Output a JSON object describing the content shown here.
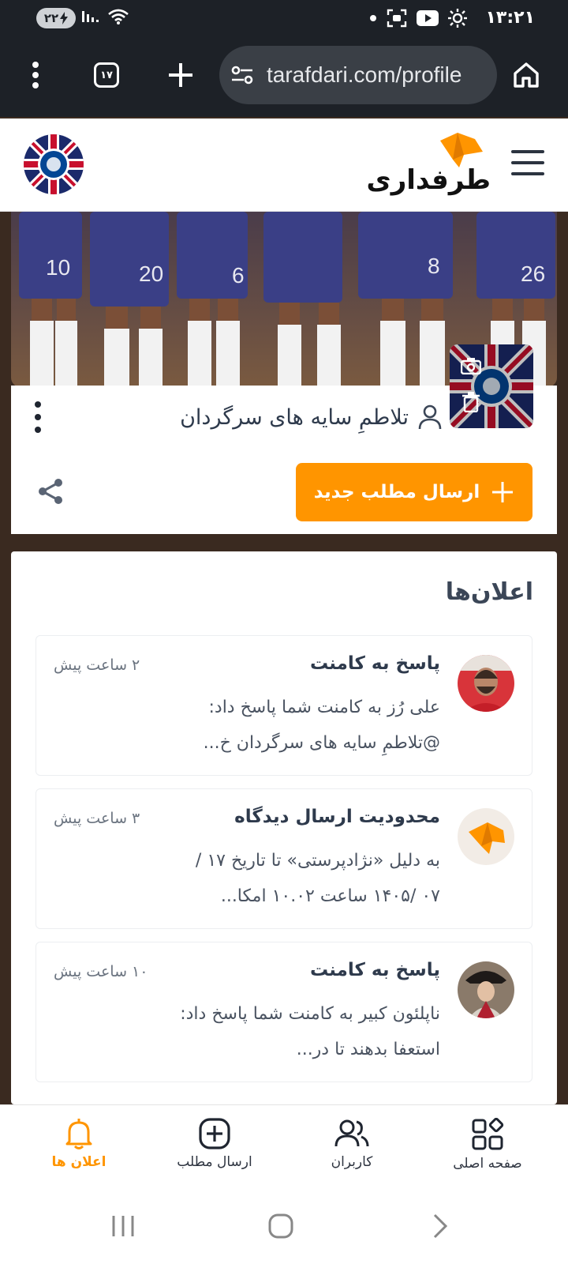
{
  "status_bar": {
    "time": "۱۳:۲۱",
    "battery_level": "۲۲"
  },
  "browser": {
    "url": "tarafdari.com/profile",
    "tab_count": "۱۷"
  },
  "site": {
    "logo_text": "طرفداری",
    "brand_color": "#ff9500"
  },
  "profile": {
    "name": "تلاطمِ سایه های سرگردان",
    "new_post_label": "ارسال مطلب جدید"
  },
  "notifications": {
    "title": "اعلان‌ها",
    "items": [
      {
        "heading": "پاسخ به کامنت",
        "time": "۲ ساعت پیش",
        "body": "علی رُز به کامنت شما پاسخ داد: @تلاطمِ سایه های سرگردان خ...",
        "avatar": "player-avatar"
      },
      {
        "heading": "محدودیت ارسال دیدگاه",
        "time": "۳ ساعت پیش",
        "body": "به دلیل «نژادپرستی» تا تاریخ ۱۷ /۰۷ /۱۴۰۵ ساعت ۱۰.۰۲ امکا...",
        "avatar": "tarafdari-logo-avatar"
      },
      {
        "heading": "پاسخ به کامنت",
        "time": "۱۰ ساعت پیش",
        "body": "ناپلئون کبیر به کامنت شما پاسخ داد: استعفا بدهند تا در...",
        "avatar": "napoleon-avatar"
      }
    ]
  },
  "bottom_nav": {
    "items": [
      {
        "label": "اعلان ها",
        "icon": "bell-icon",
        "active": true
      },
      {
        "label": "ارسال مطلب",
        "icon": "plus-square-icon",
        "active": false
      },
      {
        "label": "کاربران",
        "icon": "users-icon",
        "active": false
      },
      {
        "label": "صفحه اصلی",
        "icon": "grid-icon",
        "active": false
      }
    ]
  }
}
